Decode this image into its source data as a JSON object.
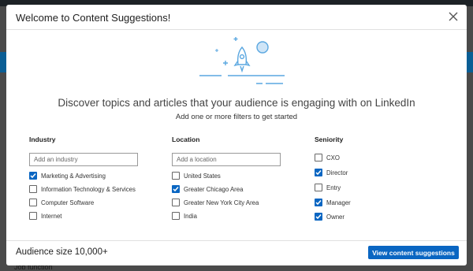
{
  "background": {
    "footer_text": "Job function"
  },
  "modal": {
    "title": "Welcome to Content Suggestions!",
    "headline": "Discover topics and articles that your audience is engaging with on LinkedIn",
    "subline": "Add one or more filters to get started"
  },
  "filters": {
    "industry": {
      "title": "Industry",
      "placeholder": "Add an industry",
      "options": [
        {
          "label": "Marketing & Advertising",
          "checked": true
        },
        {
          "label": "Information Technology & Services",
          "checked": false
        },
        {
          "label": "Computer Software",
          "checked": false
        },
        {
          "label": "Internet",
          "checked": false
        }
      ]
    },
    "location": {
      "title": "Location",
      "placeholder": "Add a location",
      "options": [
        {
          "label": "United States",
          "checked": false
        },
        {
          "label": "Greater Chicago Area",
          "checked": true
        },
        {
          "label": "Greater New York City Area",
          "checked": false
        },
        {
          "label": "India",
          "checked": false
        }
      ]
    },
    "seniority": {
      "title": "Seniority",
      "options": [
        {
          "label": "CXO",
          "checked": false
        },
        {
          "label": "Director",
          "checked": true
        },
        {
          "label": "Entry",
          "checked": false
        },
        {
          "label": "Manager",
          "checked": true
        },
        {
          "label": "Owner",
          "checked": true
        }
      ]
    }
  },
  "footer": {
    "audience": "Audience size 10,000+",
    "cta_label": "View content suggestions"
  },
  "colors": {
    "accent": "#0a66c2",
    "illustration": "#5aa7e0"
  }
}
